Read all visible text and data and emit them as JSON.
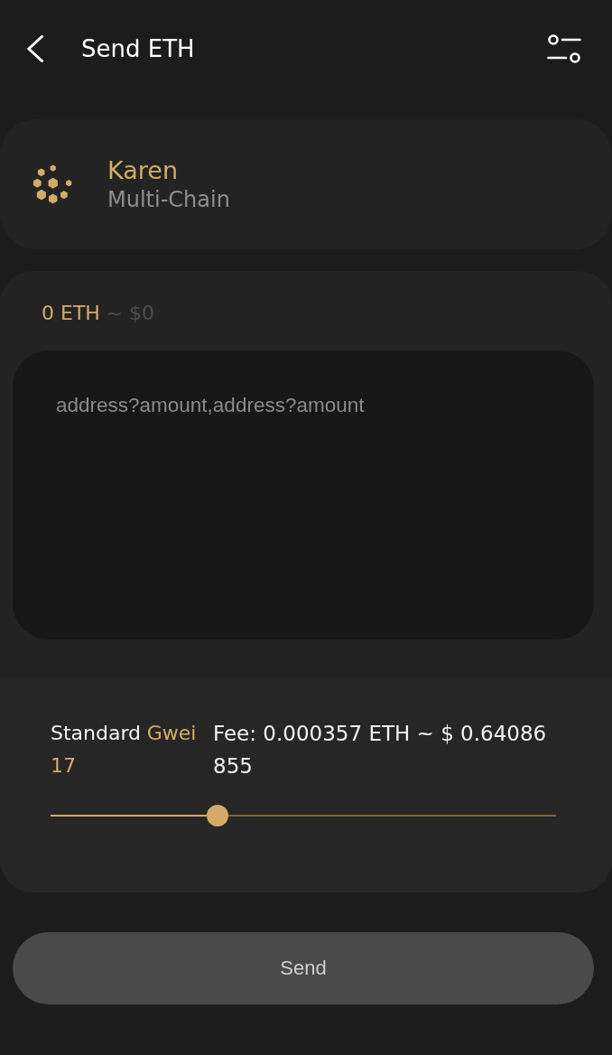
{
  "header": {
    "title": "Send ETH"
  },
  "account": {
    "name": "Karen",
    "network": "Multi-Chain"
  },
  "balance": {
    "amount": "0 ETH",
    "fiat": "~ $0"
  },
  "recipients": {
    "placeholder": "address?amount,address?amount"
  },
  "fee": {
    "speed": "Standard",
    "unit": "Gwei",
    "gas_price": "17",
    "summary": "Fee: 0.000357 ETH ~ $ 0.64086855",
    "slider": {
      "level": 0.33
    }
  },
  "send_button": {
    "label": "Send",
    "disabled": true
  }
}
